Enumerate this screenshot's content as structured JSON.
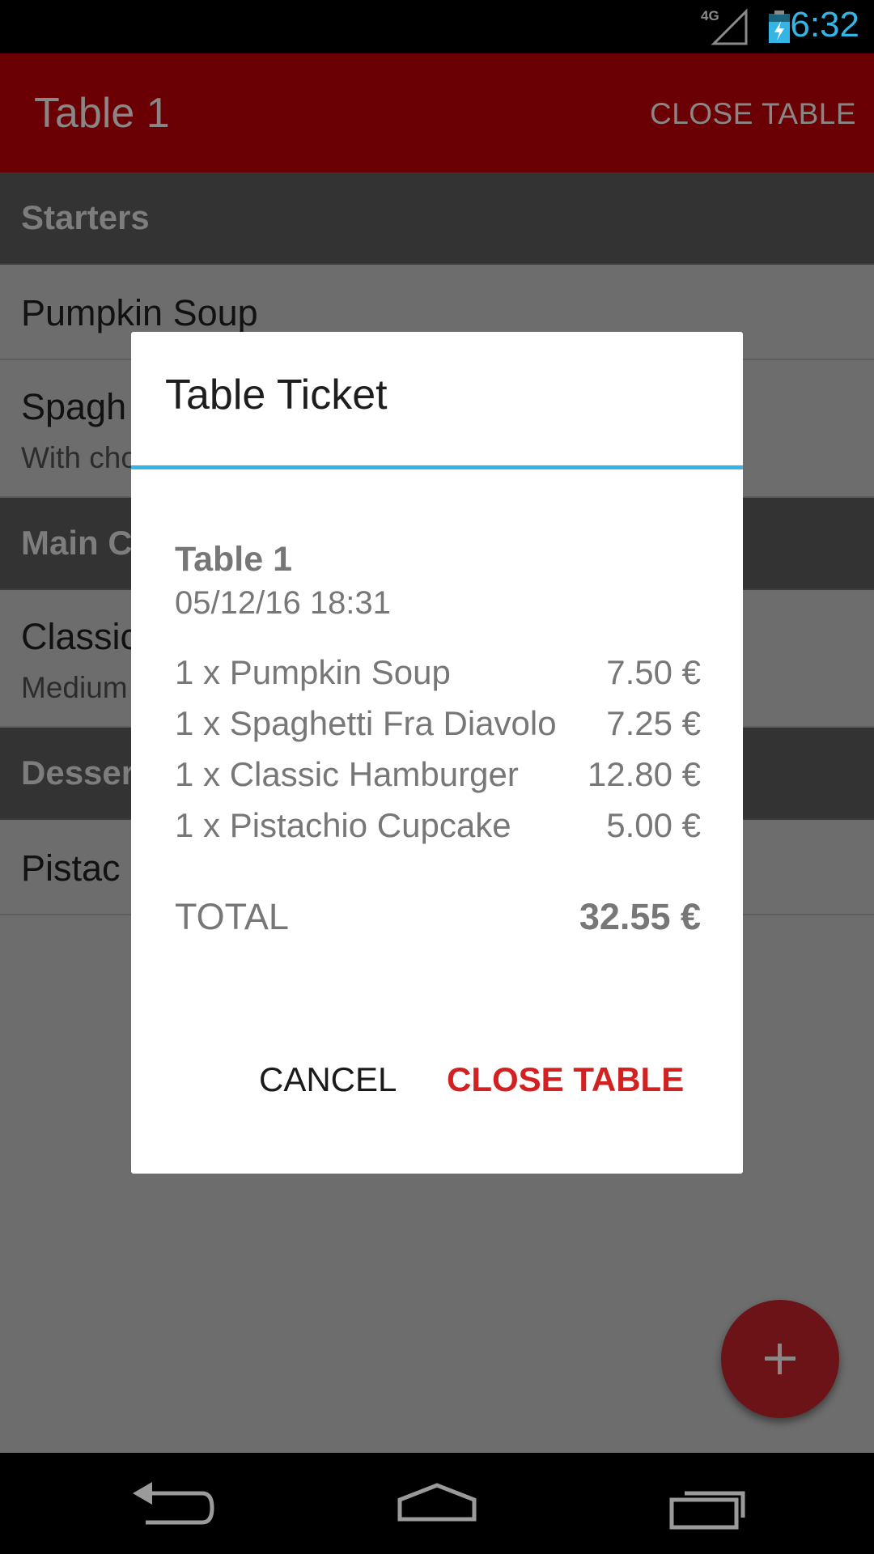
{
  "status_bar": {
    "time": "6:32",
    "network": "4G"
  },
  "app_bar": {
    "title": "Table 1",
    "action": "CLOSE TABLE"
  },
  "menu": {
    "starters_header": "Starters",
    "item1": "Pumpkin Soup",
    "item2": "Spagh",
    "item2_sub": "With cho",
    "main_header": "Main C",
    "item3": "Classic",
    "item3_sub": "Medium",
    "dessert_header": "Desser",
    "item4": "Pistac"
  },
  "dialog": {
    "title": "Table Ticket",
    "table": "Table 1",
    "datetime": "05/12/16 18:31",
    "lines": [
      {
        "item": "1 x Pumpkin Soup",
        "price": "7.50 €"
      },
      {
        "item": "1 x Spaghetti Fra Diavolo",
        "price": "7.25 €"
      },
      {
        "item": "1 x Classic Hamburger",
        "price": "12.80 €"
      },
      {
        "item": "1 x Pistachio Cupcake",
        "price": "5.00 €"
      }
    ],
    "total_label": "TOTAL",
    "total_value": "32.55 €",
    "cancel": "CANCEL",
    "confirm": "CLOSE TABLE"
  },
  "fab": {
    "icon": "plus-icon"
  },
  "colors": {
    "accent": "#33b5e5",
    "brand": "#d32020"
  }
}
